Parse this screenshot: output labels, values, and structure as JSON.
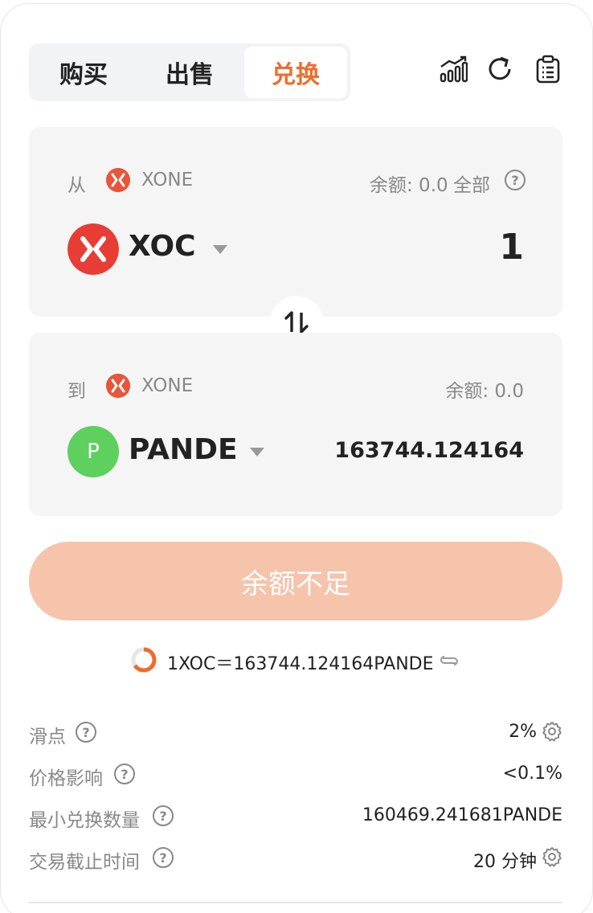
{
  "tabs": [
    {
      "label": "购买"
    },
    {
      "label": "出售"
    },
    {
      "label": "兑换"
    }
  ],
  "active_tab": "兑换",
  "icons": {
    "chart": "chart-trend-icon",
    "refresh": "refresh-icon",
    "history": "clipboard-icon"
  },
  "from": {
    "label": "从",
    "chain": "XONE",
    "balance_text": "余额: 0.0",
    "all_label": "全部",
    "token": "XOC",
    "amount": "1"
  },
  "to": {
    "label": "到",
    "chain": "XONE",
    "balance_text": "余额: 0.0",
    "token": "PANDE",
    "token_letter": "P",
    "amount": "163744.124164"
  },
  "action_button": "余额不足",
  "rate": "1XOC＝163744.124164PANDE",
  "details": [
    {
      "label": "滑点",
      "value": "2%"
    },
    {
      "label": "价格影响",
      "value": "<0.1%"
    },
    {
      "label": "最小兑换数量",
      "value": "160469.241681PANDE"
    },
    {
      "label": "交易截止时间",
      "value": "20 分钟"
    }
  ],
  "colors": {
    "accent": "#ef6c2b",
    "button_disabled": "#f6c3ab",
    "xone_red": "#e8553a",
    "pande_green": "#5dd05d"
  }
}
